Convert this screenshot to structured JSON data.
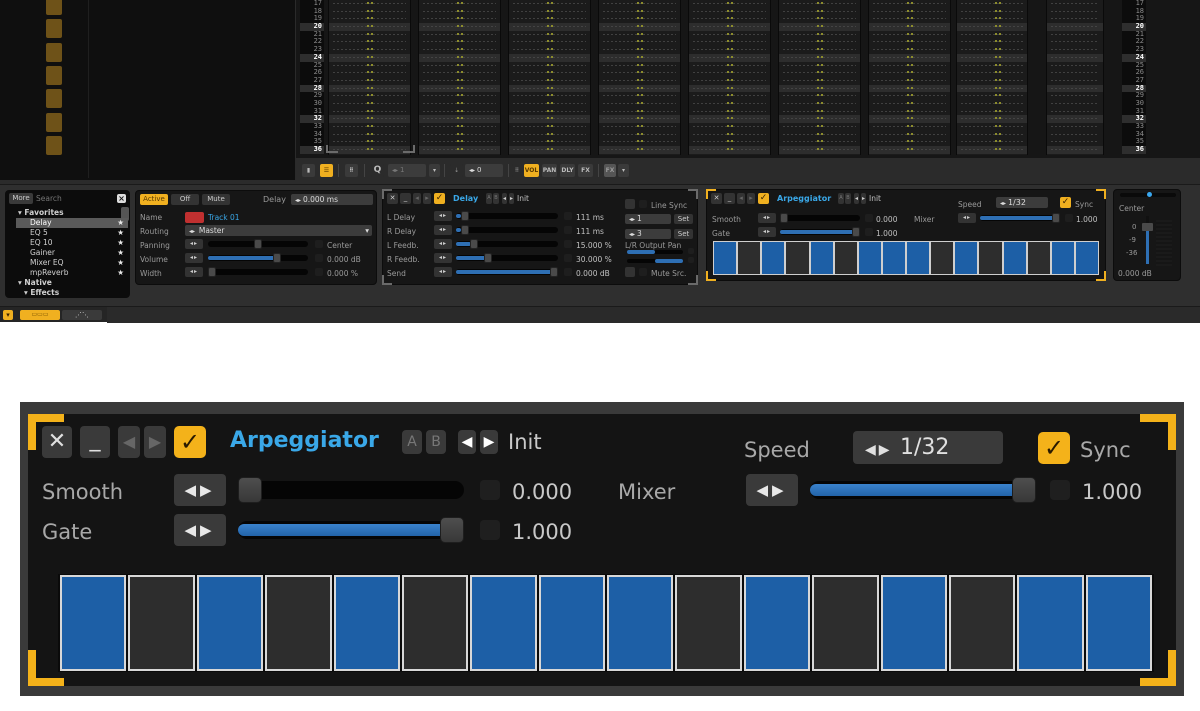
{
  "pattern_editor": {
    "row_numbers": [
      "17",
      "18",
      "19",
      "20",
      "21",
      "22",
      "23",
      "24",
      "25",
      "26",
      "27",
      "28",
      "29",
      "30",
      "31",
      "32",
      "33",
      "34",
      "35",
      "36"
    ],
    "highlight_rows": [
      "20",
      "24",
      "28",
      "32",
      "36"
    ],
    "track_count": 9
  },
  "toolbar": {
    "quantize_label": "Q",
    "quantize_value": "1",
    "edit_step_value": "0",
    "column_buttons": [
      "VOL",
      "PAN",
      "DLY",
      "FX"
    ],
    "active_column": "VOL",
    "fx_button": "FX"
  },
  "browser": {
    "more_label": "More",
    "search_placeholder": "Search",
    "tree": [
      {
        "label": "Favorites",
        "type": "folder"
      },
      {
        "label": "Delay",
        "type": "item",
        "favorite": true,
        "selected": true
      },
      {
        "label": "EQ 5",
        "type": "item",
        "favorite": true
      },
      {
        "label": "EQ 10",
        "type": "item",
        "favorite": true
      },
      {
        "label": "Gainer",
        "type": "item",
        "favorite": true
      },
      {
        "label": "Mixer EQ",
        "type": "item",
        "favorite": true
      },
      {
        "label": "mpReverb",
        "type": "item",
        "favorite": true
      },
      {
        "label": "Native",
        "type": "folder"
      },
      {
        "label": "Effects",
        "type": "subfolder"
      }
    ]
  },
  "track_panel": {
    "state_buttons": [
      "Active",
      "Off",
      "Mute"
    ],
    "active_state": "Active",
    "delay_label": "Delay",
    "delay_value": "0.000 ms",
    "name_label": "Name",
    "track_name": "Track 01",
    "track_color": "#c03030",
    "routing_label": "Routing",
    "routing_value": "Master",
    "panning_label": "Panning",
    "panning_value": "Center",
    "panning_level": 0.5,
    "volume_label": "Volume",
    "volume_value": "0.000 dB",
    "volume_level": 0.71,
    "width_label": "Width",
    "width_value": "0.000 %",
    "width_level": 0.0
  },
  "delay_device": {
    "title": "Delay",
    "preset": "Init",
    "ab_labels": [
      "A",
      "B"
    ],
    "enabled": true,
    "params": [
      {
        "label": "L Delay",
        "value": "111 ms",
        "level": 0.05
      },
      {
        "label": "R Delay",
        "value": "111 ms",
        "level": 0.05
      },
      {
        "label": "L Feedb.",
        "value": "15.000 %",
        "level": 0.15
      },
      {
        "label": "R Feedb.",
        "value": "30.000 %",
        "level": 0.3
      },
      {
        "label": "Send",
        "value": "0.000 dB",
        "level": 1.0
      }
    ],
    "line_sync_label": "Line Sync",
    "line_sync_checked": false,
    "l_lines_value": "1",
    "r_lines_value": "3",
    "set_label": "Set",
    "output_pan_label": "L/R Output Pan",
    "l_pan_level": 0.0,
    "r_pan_level": 1.0,
    "mute_src_label": "Mute Src.",
    "mute_src_checked": false
  },
  "arpeggiator_device": {
    "title": "Arpeggiator",
    "preset": "Init",
    "ab_labels": [
      "A",
      "B"
    ],
    "enabled": true,
    "speed_label": "Speed",
    "speed_value": "1/32",
    "sync_label": "Sync",
    "sync_checked": true,
    "smooth_label": "Smooth",
    "smooth_value": "0.000",
    "smooth_level": 0.0,
    "gate_label": "Gate",
    "gate_value": "1.000",
    "gate_level": 1.0,
    "mixer_label": "Mixer",
    "mixer_value": "1.000",
    "mixer_level": 1.0,
    "steps": [
      1,
      0,
      1,
      0,
      1,
      0,
      1,
      1,
      1,
      0,
      1,
      0,
      1,
      0,
      1,
      1
    ]
  },
  "mixer_strip": {
    "pan_label": "Center",
    "pan_level": 0.5,
    "scale_labels": [
      "0",
      "-9",
      "-36"
    ],
    "volume_value": "0.000 dB"
  },
  "colors": {
    "accent": "#f0b020",
    "slider_blue": "#2e6fb4",
    "title_blue": "#3aa8e8",
    "step_on": "#1d5fa6",
    "step_off": "#2d2d2d"
  }
}
